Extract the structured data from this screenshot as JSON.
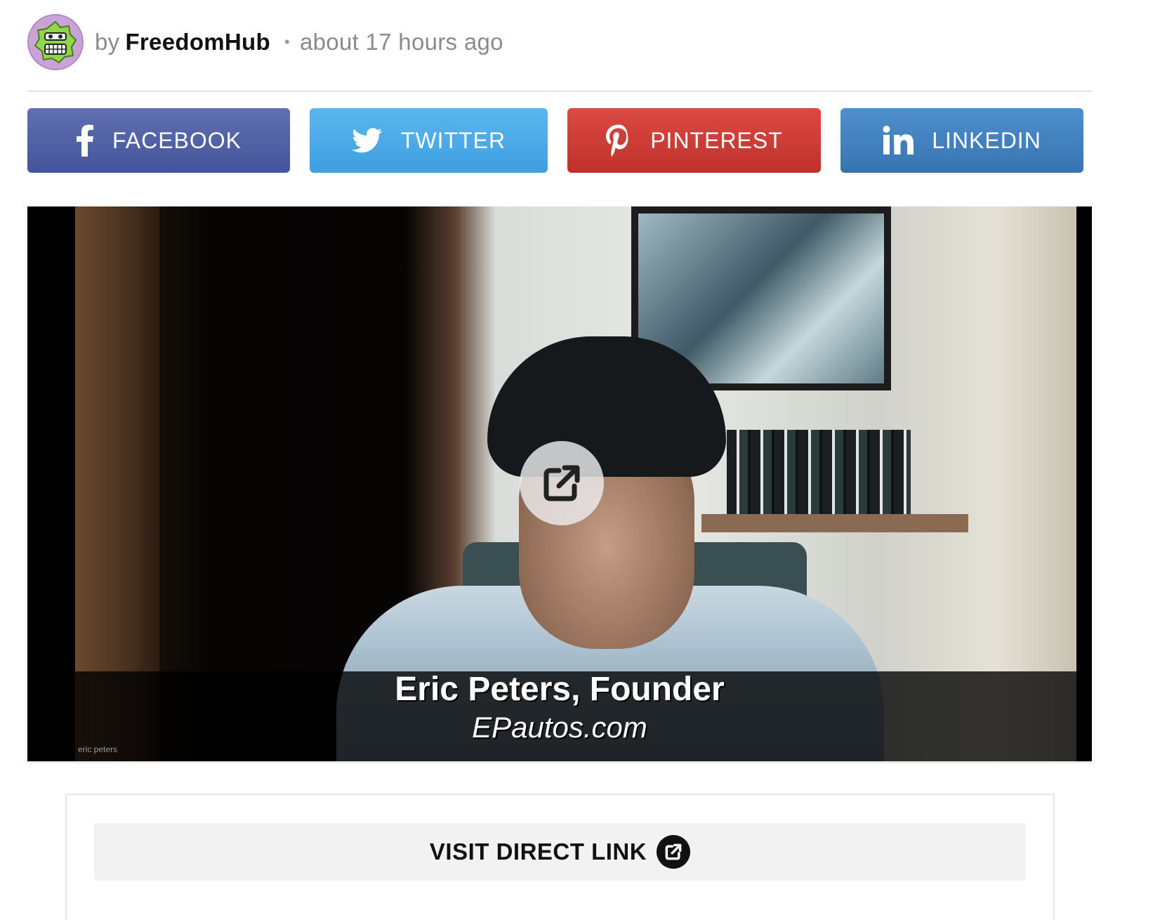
{
  "byline": {
    "by": "by",
    "author": "FreedomHub",
    "separator": "•",
    "time": "about 17 hours ago"
  },
  "share_buttons": [
    {
      "label": "FACEBOOK",
      "icon": "facebook-icon",
      "color": "#4f60a6"
    },
    {
      "label": "TWITTER",
      "icon": "twitter-icon",
      "color": "#4aaae8"
    },
    {
      "label": "PINTEREST",
      "icon": "pinterest-icon",
      "color": "#cd3c35"
    },
    {
      "label": "LINKEDIN",
      "icon": "linkedin-icon",
      "color": "#4280bf"
    }
  ],
  "video": {
    "caption_name": "Eric Peters, Founder",
    "caption_site": "EPautos.com",
    "watermark": "eric peters",
    "overlay_icon": "external-link-icon"
  },
  "direct_link": {
    "label": "VISIT DIRECT LINK",
    "icon": "external-link-icon"
  }
}
